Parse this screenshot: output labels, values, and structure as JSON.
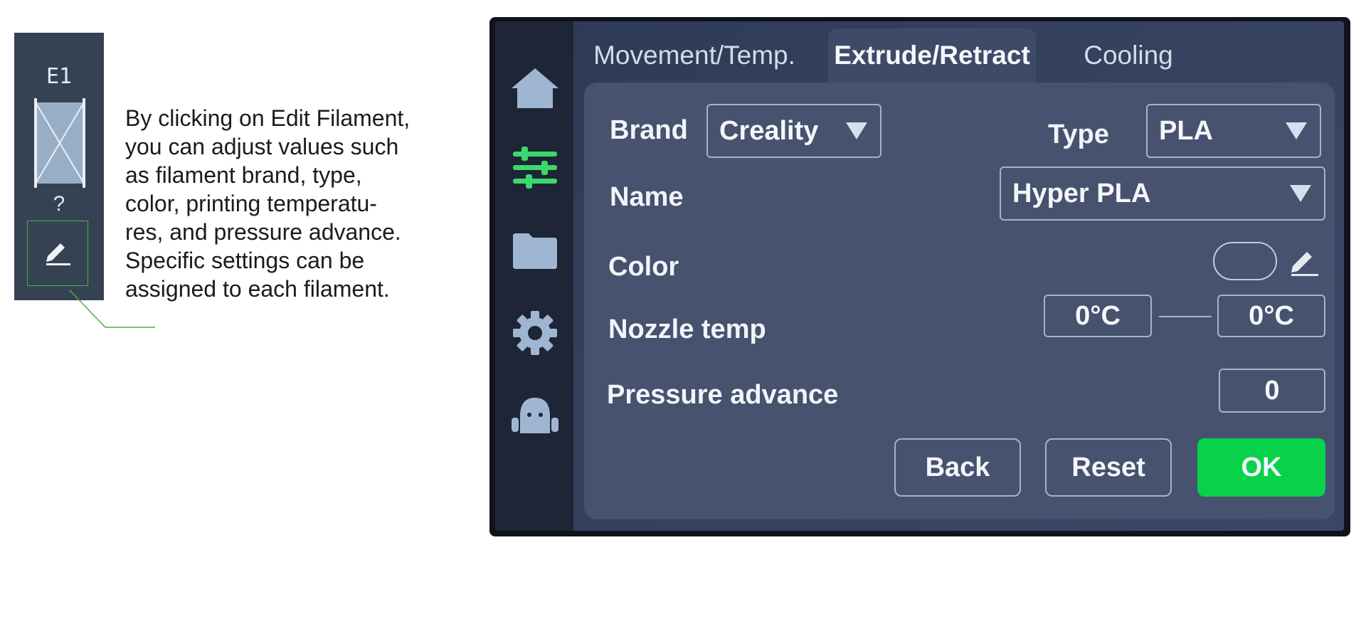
{
  "slot": {
    "label": "E1",
    "unknown_mark": "?",
    "edit_icon": "pencil-edit-icon",
    "spool_icon": "empty-spool-icon"
  },
  "description": [
    "By clicking on Edit Filament,",
    "you can adjust values such",
    "as filament brand, type,",
    "color, printing temperatu-",
    "res, and pressure advance.",
    "Specific settings can be",
    "assigned to each filament."
  ],
  "sidebar": {
    "items": [
      {
        "icon": "home-icon",
        "active": false
      },
      {
        "icon": "sliders-icon",
        "active": true
      },
      {
        "icon": "folder-icon",
        "active": false
      },
      {
        "icon": "gear-icon",
        "active": false
      },
      {
        "icon": "robot-icon",
        "active": false
      }
    ]
  },
  "tabs": [
    {
      "label": "Movement/Temp.",
      "active": false
    },
    {
      "label": "Extrude/Retract",
      "active": true
    },
    {
      "label": "Cooling",
      "active": false
    }
  ],
  "form": {
    "brand": {
      "label": "Brand",
      "value": "Creality"
    },
    "type": {
      "label": "Type",
      "value": "PLA"
    },
    "name": {
      "label": "Name",
      "value": "Hyper PLA"
    },
    "color": {
      "label": "Color",
      "edit_icon": "pencil-edit-icon"
    },
    "nozzle": {
      "label": "Nozzle temp",
      "min": "0°C",
      "max": "0°C"
    },
    "pressure": {
      "label": "Pressure advance",
      "value": "0"
    }
  },
  "buttons": {
    "back": "Back",
    "reset": "Reset",
    "ok": "OK"
  },
  "colors": {
    "accent": "#08d24a",
    "active_icon": "#3bd96b",
    "screen_bg": "#35425e",
    "panel_bg": "#46526e"
  }
}
